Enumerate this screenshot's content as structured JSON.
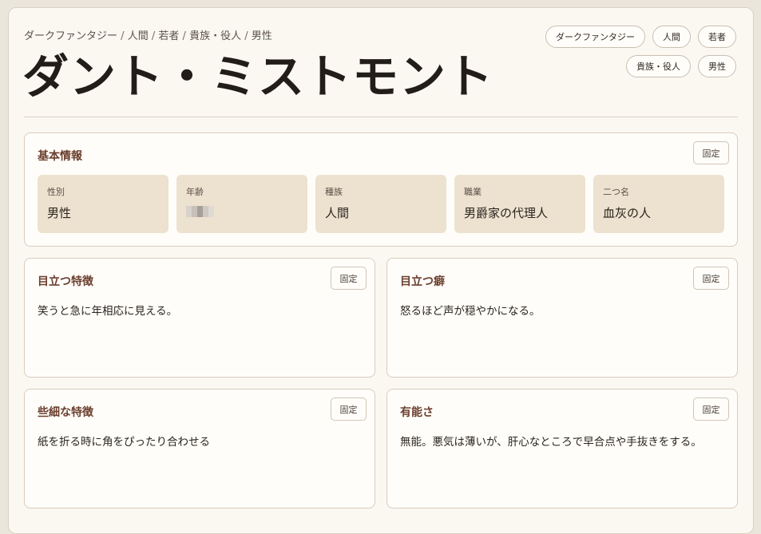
{
  "breadcrumb": [
    "ダークファンタジー",
    "人間",
    "若者",
    "貴族・役人",
    "男性"
  ],
  "breadcrumb_separator": "/",
  "title": "ダント・ミストモント",
  "tags": [
    "ダークファンタジー",
    "人間",
    "若者",
    "貴族・役人",
    "男性"
  ],
  "pin_label": "固定",
  "basic": {
    "title": "基本情報",
    "fields": [
      {
        "label": "性別",
        "value": "男性"
      },
      {
        "label": "年齢",
        "value": ""
      },
      {
        "label": "種族",
        "value": "人間"
      },
      {
        "label": "職業",
        "value": "男爵家の代理人"
      },
      {
        "label": "二つ名",
        "value": "血灰の人"
      }
    ]
  },
  "cards": [
    {
      "title": "目立つ特徴",
      "body": "笑うと急に年相応に見える。"
    },
    {
      "title": "目立つ癖",
      "body": "怒るほど声が穏やかになる。"
    },
    {
      "title": "些細な特徴",
      "body": "紙を折る時に角をぴったり合わせる"
    },
    {
      "title": "有能さ",
      "body": "無能。悪気は薄いが、肝心なところで早合点や手抜きをする。"
    }
  ]
}
